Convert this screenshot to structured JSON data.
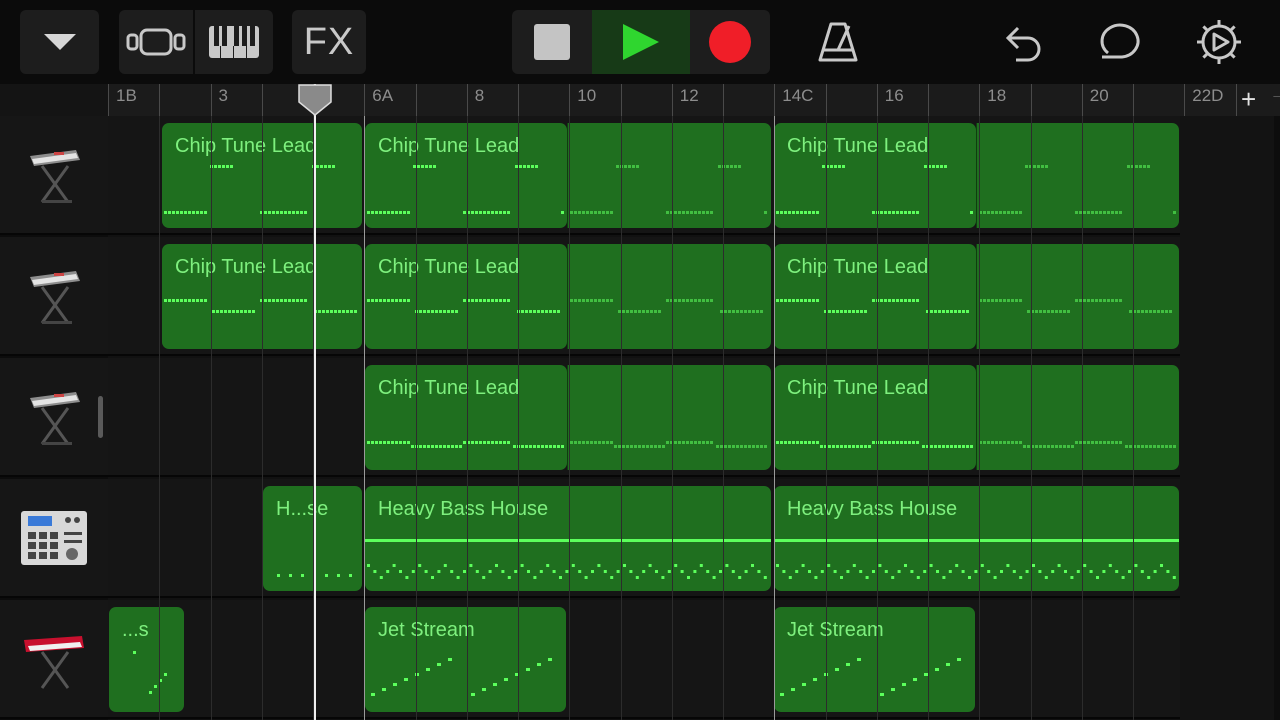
{
  "toolbar": {
    "fx_label": "FX",
    "icons": [
      "chevron-down-icon",
      "browser-icon",
      "keyboard-icon",
      "stop-icon",
      "play-icon",
      "record-icon",
      "metronome-icon",
      "undo-icon",
      "loop-icon",
      "settings-icon"
    ],
    "play_color": "#2fd62f",
    "record_color": "#f01e28"
  },
  "ruler": {
    "labels": [
      "1B",
      "3",
      "5",
      "6A",
      "8",
      "10",
      "12",
      "14C",
      "16",
      "18",
      "20",
      "22D"
    ],
    "add_label": "+",
    "edge_label": "→"
  },
  "tracks": [
    {
      "instrument": "synth-keyboard-icon",
      "regions": [
        "Chip Tune Lead",
        "Chip Tune Lead",
        "",
        "Chip Tune Lead",
        ""
      ]
    },
    {
      "instrument": "synth-keyboard-icon",
      "regions": [
        "Chip Tune Lead",
        "Chip Tune Lead",
        "",
        "Chip Tune Lead",
        ""
      ]
    },
    {
      "instrument": "synth-keyboard-icon",
      "regions": [
        "Chip Tune Lead",
        "",
        "Chip Tune Lead",
        ""
      ]
    },
    {
      "instrument": "drum-machine-icon",
      "regions": [
        "H...se",
        "Heavy Bass House",
        "Heavy Bass House"
      ]
    },
    {
      "instrument": "red-keyboard-icon",
      "regions": [
        "...s",
        "Jet Stream",
        "Jet Stream"
      ]
    }
  ],
  "colors": {
    "region_fill": "#1f6f1f",
    "region_text": "#7ef07e",
    "note": "#5cff5c"
  }
}
